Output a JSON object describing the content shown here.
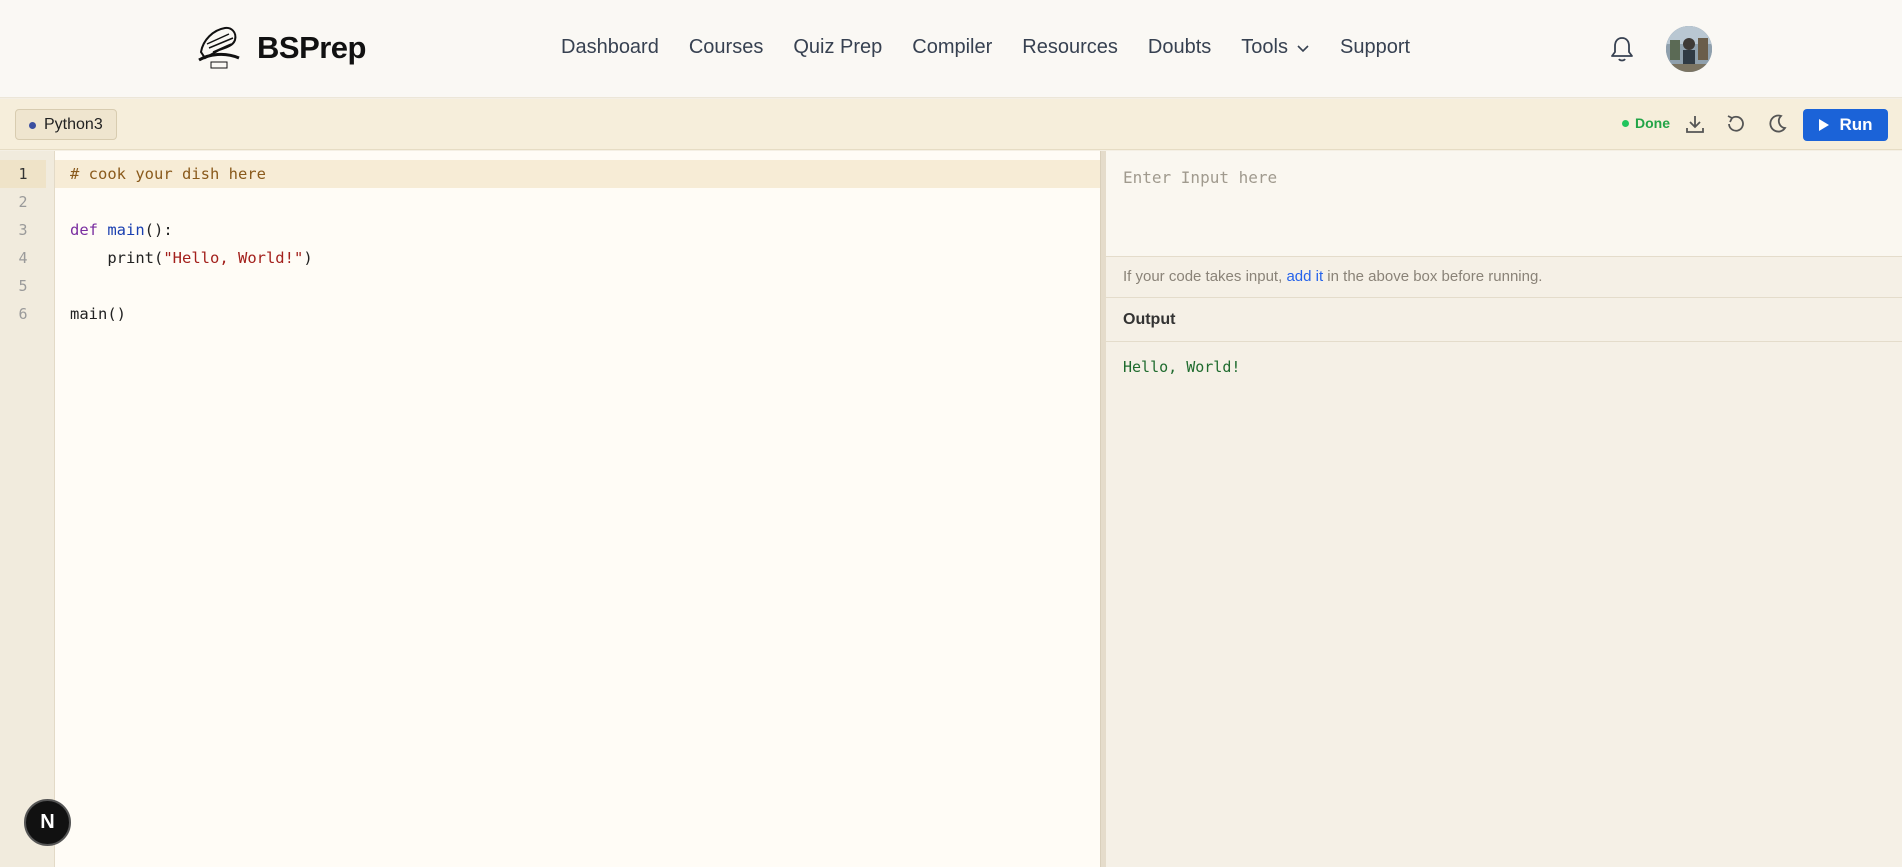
{
  "brand": {
    "name": "BSPrep"
  },
  "nav": {
    "items": [
      {
        "label": "Dashboard"
      },
      {
        "label": "Courses"
      },
      {
        "label": "Quiz Prep"
      },
      {
        "label": "Compiler"
      },
      {
        "label": "Resources"
      },
      {
        "label": "Doubts"
      },
      {
        "label": "Tools"
      },
      {
        "label": "Support"
      }
    ]
  },
  "toolbar": {
    "language": "Python3",
    "status": "Done",
    "run_label": "Run"
  },
  "editor": {
    "line_numbers": [
      "1",
      "2",
      "3",
      "4",
      "5",
      "6"
    ],
    "lines": {
      "l1_comment": "# cook your dish here",
      "l3_kw": "def",
      "l3_fn": "main",
      "l3_rest": "():",
      "l4_pre": "    print(",
      "l4_str": "\"Hello, World!\"",
      "l4_post": ")",
      "l6": "main()"
    }
  },
  "input": {
    "placeholder": "Enter Input here",
    "hint_pre": "If your code takes input, ",
    "hint_link": "add it",
    "hint_post": " in the above box before running."
  },
  "output": {
    "heading": "Output",
    "text": "Hello, World!"
  },
  "badge": {
    "letter": "N"
  },
  "colors": {
    "accent": "#1b63d8",
    "status_done": "#22a447",
    "output_text": "#1f6b2e"
  }
}
